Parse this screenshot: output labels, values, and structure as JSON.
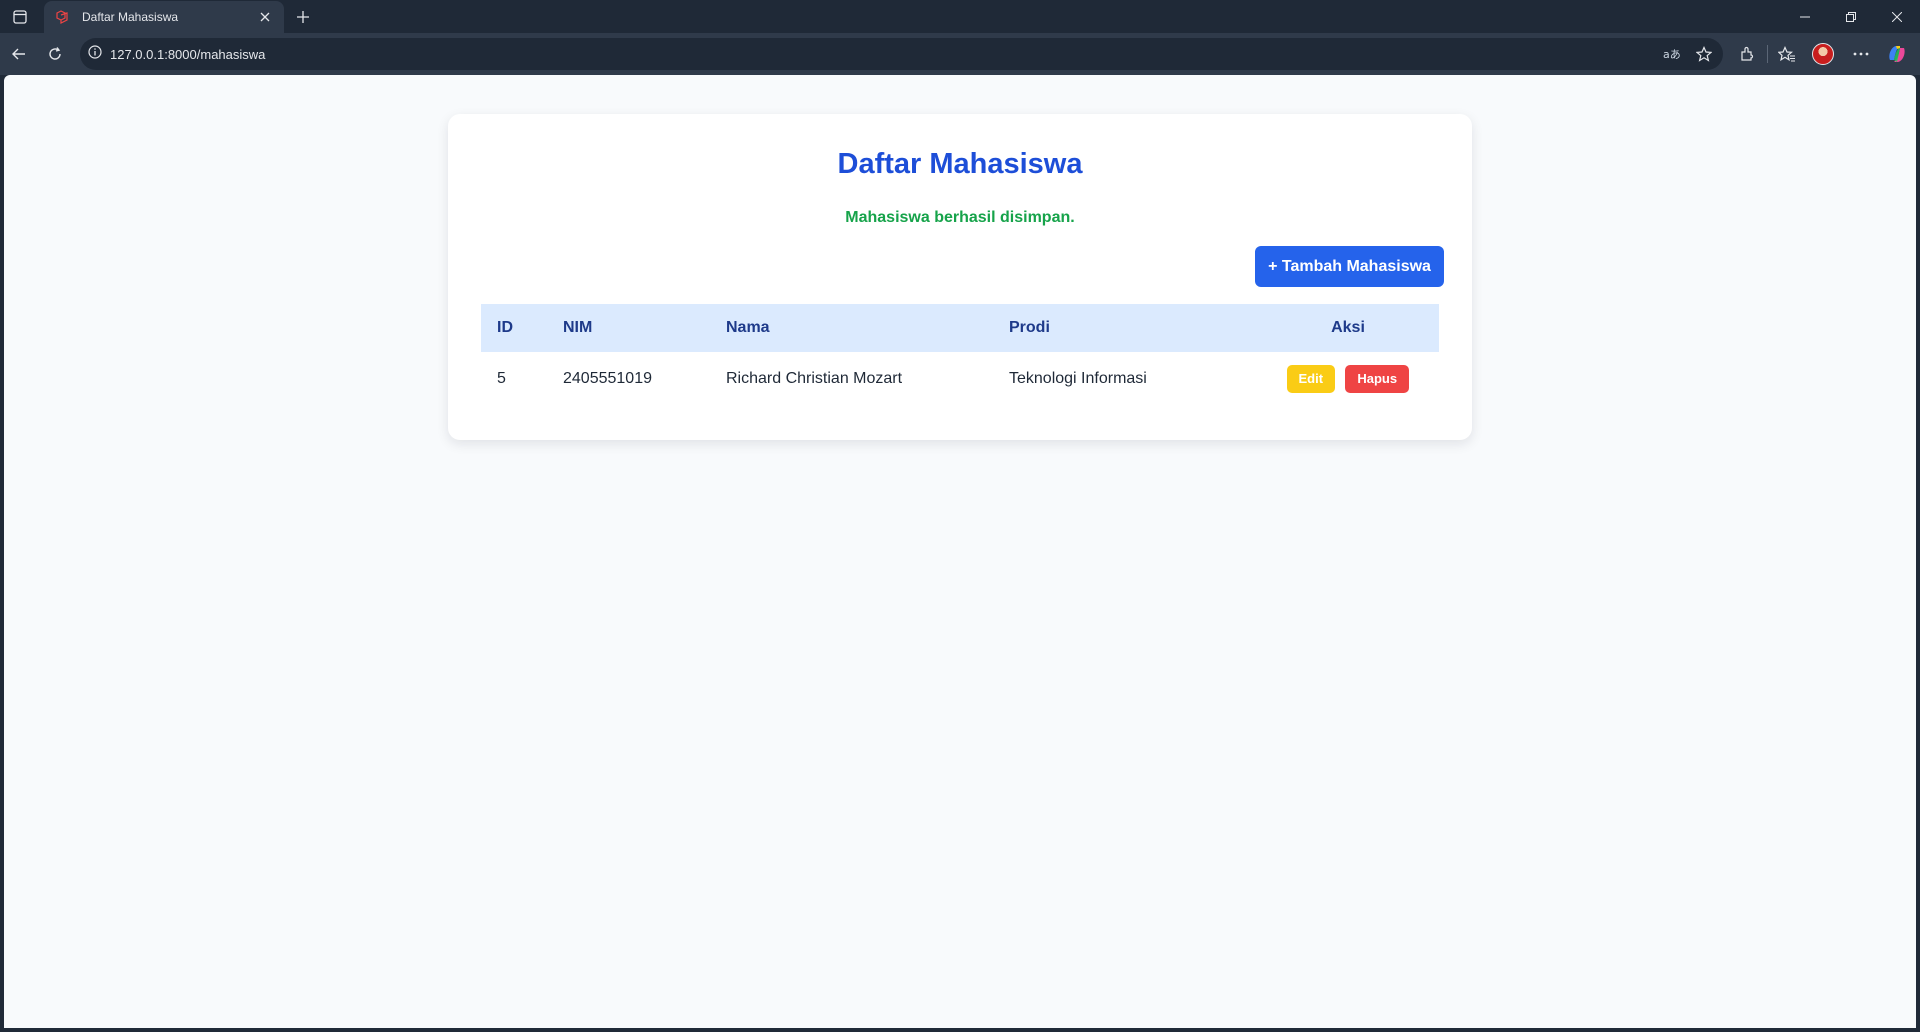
{
  "browser": {
    "tab_title": "Daftar Mahasiswa",
    "url": "127.0.0.1:8000/mahasiswa",
    "icons": [
      "tab-actions-icon",
      "laravel-favicon-icon",
      "close-icon",
      "plus-icon",
      "minimize-icon",
      "restore-icon",
      "window-close-icon",
      "back-icon",
      "reload-icon",
      "info-icon",
      "read-aloud-icon",
      "favorite-star-icon",
      "extensions-icon",
      "favorites-icon",
      "more-icon",
      "copilot-icon"
    ]
  },
  "page": {
    "title": "Daftar Mahasiswa",
    "flash_message": "Mahasiswa berhasil disimpan.",
    "add_button_label": "+ Tambah Mahasiswa"
  },
  "table": {
    "columns": [
      "ID",
      "NIM",
      "Nama",
      "Prodi",
      "Aksi"
    ],
    "rows": [
      {
        "id": "5",
        "nim": "2405551019",
        "nama": "Richard Christian Mozart",
        "prodi": "Teknologi Informasi",
        "edit_label": "Edit",
        "delete_label": "Hapus"
      }
    ]
  },
  "colors": {
    "title": "#1d4ed8",
    "success": "#16a34a",
    "primary_button": "#2563eb",
    "table_header_bg": "#dbeafe",
    "edit_button": "#facc15",
    "delete_button": "#ef4444"
  }
}
